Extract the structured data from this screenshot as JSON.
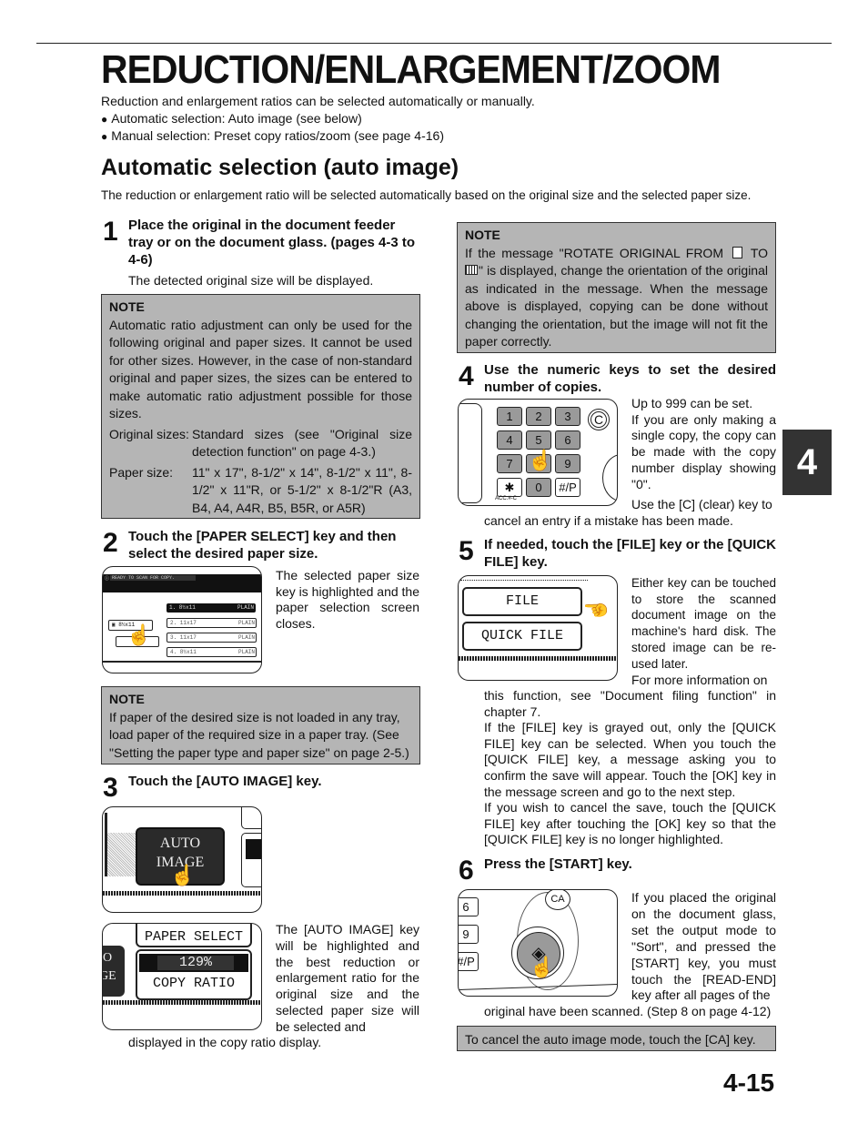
{
  "page": {
    "title": "REDUCTION/ENLARGEMENT/ZOOM",
    "intro": "Reduction and enlargement ratios can be selected automatically or manually.",
    "bullets": [
      "Automatic selection: Auto image (see below)",
      "Manual selection: Preset copy ratios/zoom (see page 4-16)"
    ],
    "section_title": "Automatic selection (auto image)",
    "section_intro": "The reduction or enlargement ratio will be selected automatically based on the original size and the selected paper size.",
    "chapter_tab": "4",
    "page_number": "4-15"
  },
  "steps": [
    {
      "number": "1",
      "heading": "Place the original in the document feeder tray or on the document glass. (pages 4-3 to 4-6)",
      "text": "The detected original size will be displayed."
    },
    {
      "number": "2",
      "heading": "Touch the [PAPER SELECT] key and then select the desired paper size.",
      "text": "The selected paper size key is highlighted and the paper selection screen closes."
    },
    {
      "number": "3",
      "heading": "Touch the [AUTO IMAGE] key.",
      "text": "The [AUTO IMAGE] key will be highlighted and the best reduction or enlargement ratio for the original size and the selected paper size will be selected and displayed in the copy ratio display."
    },
    {
      "number": "4",
      "heading": "Use the numeric keys to set the desired number of copies.",
      "text_lines": [
        "Up to 999 can be set.",
        "If you are only making a single copy, the copy can be made with the copy number display showing \"0\".",
        "Use the [C] (clear) key to cancel an entry if a mistake has been made."
      ]
    },
    {
      "number": "5",
      "heading": "If needed, touch the [FILE] key or the [QUICK FILE] key.",
      "text_lines": [
        "Either key can be touched to store the scanned document image on the machine's hard disk. The stored image can be re-used later.",
        "For more information on this function, see \"Document filing function\" in chapter 7.",
        "If the [FILE] key is grayed out, only the [QUICK FILE] key can be selected. When you touch the [QUICK FILE] key, a message asking you to confirm the save will appear. Touch the [OK] key in the message screen and go to the next step.",
        "If you wish to cancel the save, touch the [QUICK FILE] key after touching the [OK] key so that the [QUICK FILE] key is no longer highlighted."
      ]
    },
    {
      "number": "6",
      "heading": "Press the [START] key.",
      "text": "If you placed the original on the document glass, set the output mode to \"Sort\", and pressed the [START] key, you must touch the [READ-END] key after all pages of the original have been scanned. (Step 8 on page 4-12)"
    }
  ],
  "notes": {
    "note1": {
      "title": "NOTE",
      "text": "Automatic ratio adjustment can only be used for the following original and paper sizes. It cannot be used for other sizes. However, in the case of non-standard original and paper sizes, the sizes can be entered to make automatic ratio adjustment possible for those sizes.",
      "original_label": "Original sizes:",
      "original_value": "Standard sizes (see \"Original size detection function\" on page 4-3.)",
      "paper_label": "Paper size:",
      "paper_value": "11\" x 17\", 8-1/2\" x 14\", 8-1/2\" x 11\", 8-1/2\" x 11\"R, or 5-1/2\" x 8-1/2\"R (A3, B4, A4, A4R, B5, B5R, or A5R)"
    },
    "note2": {
      "title": "NOTE",
      "text": "If paper of the desired size is not loaded in any tray, load paper of the required size in a paper tray. (See \"Setting the paper type and paper size\" on page 2-5.)"
    },
    "note3": {
      "title": "NOTE",
      "text_a": "If the message \"ROTATE ORIGINAL FROM",
      "text_b": "TO",
      "text_c": "\" is displayed, change the orientation of the original as indicated in the message. When the message above is displayed, copying can be done without changing the orientation, but the image will not fit the paper correctly."
    },
    "bottom": {
      "text": "To cancel the auto image mode, touch the [CA] key."
    }
  },
  "illustrations": {
    "paper_select_screen": {
      "status": "READY TO SCAN FOR COPY.",
      "current_size": "8½x11",
      "trays": [
        {
          "label": "1. 8½x11",
          "type": "PLAIN",
          "selected": true
        },
        {
          "label": "2. 11x17",
          "type": "PLAIN",
          "selected": false
        },
        {
          "label": "3. 11x17",
          "type": "PLAIN",
          "selected": false
        },
        {
          "label": "4. 8½x11",
          "type": "PLAIN",
          "selected": false
        }
      ]
    },
    "auto_image_key": {
      "line1": "AUTO",
      "line2": "IMAGE"
    },
    "copy_ratio_screen": {
      "paper_select": "PAPER SELECT",
      "ratio": "129%",
      "copy_ratio": "COPY RATIO",
      "partial_left_1": "O",
      "partial_left_2": "GE"
    },
    "keypad": {
      "keys": [
        "1",
        "2",
        "3",
        "4",
        "5",
        "6",
        "7",
        "8",
        "9",
        "✱",
        "0",
        "#/P"
      ],
      "clear": "C",
      "acc_label": "ACC.#-C"
    },
    "file_screen": {
      "file": "FILE",
      "quick_file": "QUICK FILE"
    },
    "start_panel": {
      "keys": [
        "6",
        "9",
        "#/P"
      ],
      "ca": "CA"
    }
  },
  "colors": {
    "note_bg": "#b5b5b5",
    "tab_bg": "#333333",
    "key_gray": "#9a9a9a"
  }
}
